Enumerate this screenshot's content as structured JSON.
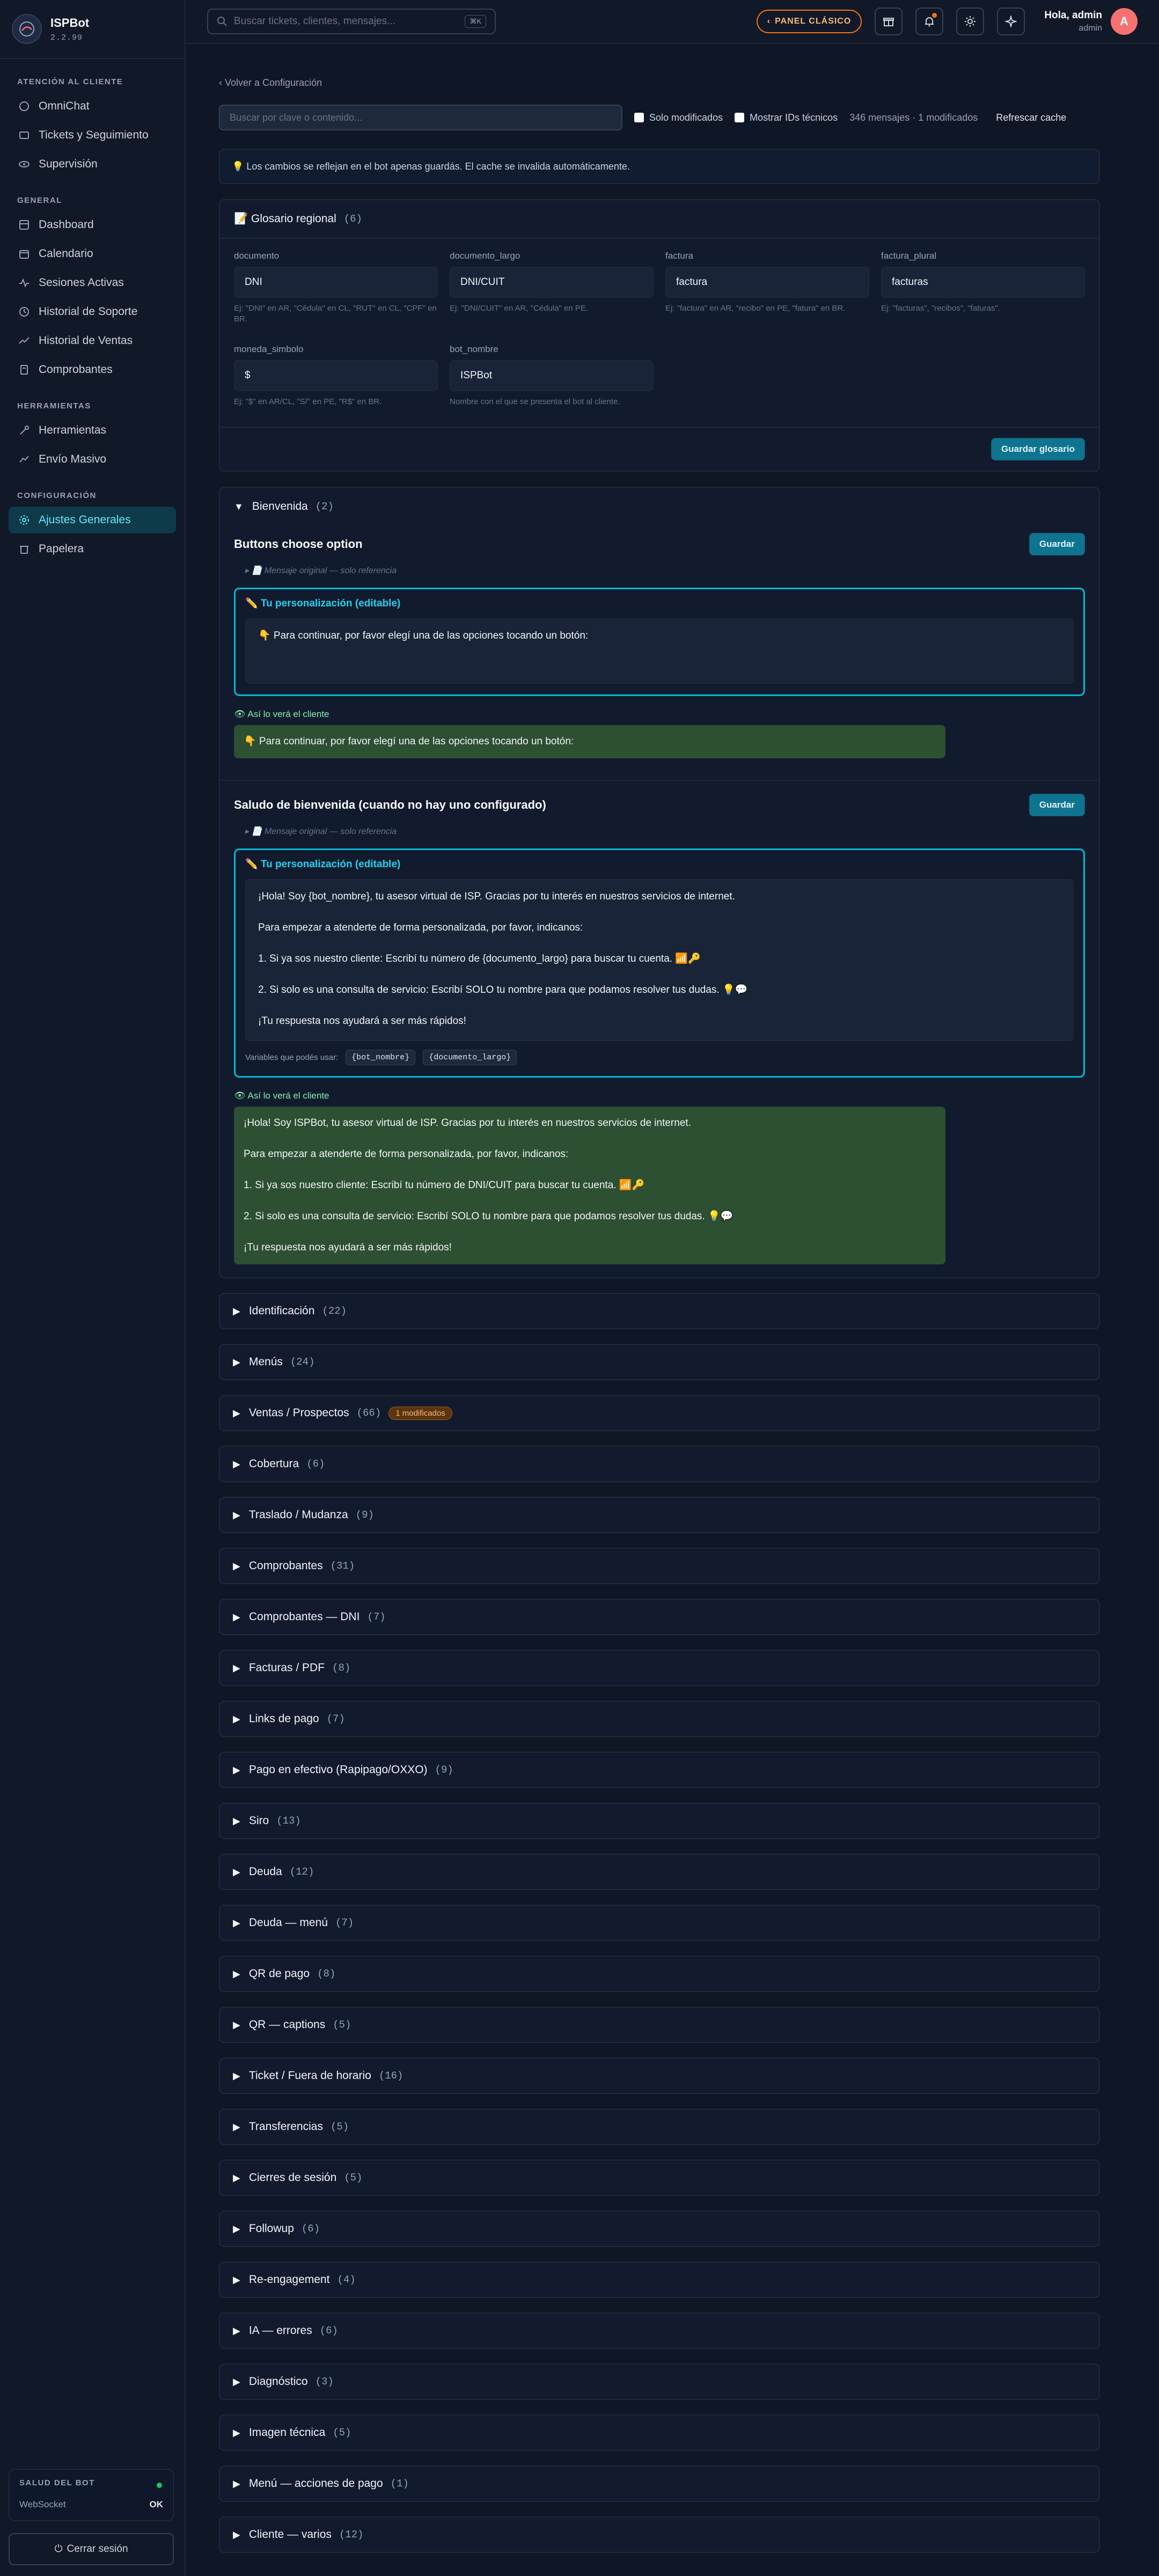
{
  "brand": {
    "name": "ISPBot",
    "version": "2.2.99"
  },
  "sidebar": {
    "sections": [
      {
        "title": "ATENCIÓN AL CLIENTE",
        "items": [
          {
            "label": "OmniChat",
            "icon": "chat-icon"
          },
          {
            "label": "Tickets y Seguimiento",
            "icon": "ticket-icon"
          },
          {
            "label": "Supervisión",
            "icon": "eye-icon"
          }
        ]
      },
      {
        "title": "GENERAL",
        "items": [
          {
            "label": "Dashboard",
            "icon": "dashboard-icon"
          },
          {
            "label": "Calendario",
            "icon": "calendar-icon"
          },
          {
            "label": "Sesiones Activas",
            "icon": "activity-icon"
          },
          {
            "label": "Historial de Soporte",
            "icon": "history-icon"
          },
          {
            "label": "Historial de Ventas",
            "icon": "trend-icon"
          },
          {
            "label": "Comprobantes",
            "icon": "receipt-icon"
          }
        ]
      },
      {
        "title": "HERRAMIENTAS",
        "items": [
          {
            "label": "Herramientas",
            "icon": "wrench-icon"
          },
          {
            "label": "Envío Masivo",
            "icon": "send-icon"
          }
        ]
      },
      {
        "title": "CONFIGURACIÓN",
        "items": [
          {
            "label": "Ajustes Generales",
            "icon": "gear-icon",
            "active": true
          },
          {
            "label": "Papelera",
            "icon": "trash-icon"
          }
        ]
      }
    ],
    "health": {
      "title": "SALUD DEL BOT",
      "label": "WebSocket",
      "value": "OK"
    },
    "logout": "Cerrar sesión"
  },
  "topbar": {
    "search_placeholder": "Buscar tickets, clientes, mensajes...",
    "shortcut": "⌘K",
    "classic_panel": "PANEL CLÁSICO",
    "greeting": "Hola, admin",
    "role": "admin",
    "avatar_letter": "A"
  },
  "page": {
    "back": "‹ Volver a Configuración",
    "search_placeholder": "Buscar por clave o contenido...",
    "only_modified": "Solo modificados",
    "show_ids": "Mostrar IDs técnicos",
    "stats": "346 mensajes · 1 modificados",
    "refresh": "Refrescar cache",
    "info": "💡 Los cambios se reflejan en el bot apenas guardás. El cache se invalida automáticamente."
  },
  "glossary": {
    "title": "📝 Glosario regional",
    "count": "(6)",
    "fields": [
      {
        "label": "documento",
        "value": "DNI",
        "hint": "Ej: \"DNI\" en AR, \"Cédula\" en CL, \"RUT\" en CL, \"CPF\" en BR."
      },
      {
        "label": "documento_largo",
        "value": "DNI/CUIT",
        "hint": "Ej: \"DNI/CUIT\" en AR, \"Cédula\" en PE."
      },
      {
        "label": "factura",
        "value": "factura",
        "hint": "Ej: \"factura\" en AR, \"recibo\" en PE, \"fatura\" en BR."
      },
      {
        "label": "factura_plural",
        "value": "facturas",
        "hint": "Ej: \"facturas\", \"recibos\", \"faturas\"."
      },
      {
        "label": "moneda_simbolo",
        "value": "$",
        "hint": "Ej: \"$\" en AR/CL, \"S/\" en PE, \"R$\" en BR."
      },
      {
        "label": "bot_nombre",
        "value": "ISPBot",
        "hint": "Nombre con el que se presenta el bot al cliente."
      }
    ],
    "save": "Guardar glosario"
  },
  "welcome": {
    "title": "Bienvenida",
    "count": "(2)",
    "original_label": "📄 Mensaje original — solo referencia",
    "edit_label": "✏️ Tu personalización (editable)",
    "preview_label": "👁 Así lo verá el cliente",
    "save": "Guardar",
    "msg1": {
      "title": "Buttons choose option",
      "text": "👇 Para continuar, por favor elegí una de las opciones tocando un botón:",
      "preview": "👇 Para continuar, por favor elegí una de las opciones tocando un botón:"
    },
    "msg2": {
      "title": "Saludo de bienvenida (cuando no hay uno configurado)",
      "lines": [
        "¡Hola! Soy {bot_nombre}, tu asesor virtual de ISP. Gracias por tu interés en nuestros servicios de internet.",
        "Para empezar a atenderte de forma personalizada, por favor, indicanos:",
        "1. Si ya sos nuestro cliente: Escribí tu número de {documento_largo} para buscar tu cuenta. 📶🔑",
        "2. Si solo es una consulta de servicio: Escribí SOLO tu nombre para que podamos resolver tus dudas. 💡💬",
        "¡Tu respuesta nos ayudará a ser más rápidos!"
      ],
      "vars_label": "Variables que podés usar:",
      "vars": [
        "{bot_nombre}",
        "{documento_largo}"
      ],
      "preview_lines": [
        "¡Hola! Soy ISPBot, tu asesor virtual de ISP. Gracias por tu interés en nuestros servicios de internet.",
        "Para empezar a atenderte de forma personalizada, por favor, indicanos:",
        "1. Si ya sos nuestro cliente: Escribí tu número de DNI/CUIT para buscar tu cuenta. 📶🔑",
        "2. Si solo es una consulta de servicio: Escribí SOLO tu nombre para que podamos resolver tus dudas. 💡💬",
        "¡Tu respuesta nos ayudará a ser más rápidos!"
      ]
    }
  },
  "categories": [
    {
      "label": "Identificación",
      "count": "(22)"
    },
    {
      "label": "Menús",
      "count": "(24)"
    },
    {
      "label": "Ventas / Prospectos",
      "count": "(66)",
      "badge": "1 modificados"
    },
    {
      "label": "Cobertura",
      "count": "(6)"
    },
    {
      "label": "Traslado / Mudanza",
      "count": "(9)"
    },
    {
      "label": "Comprobantes",
      "count": "(31)"
    },
    {
      "label": "Comprobantes — DNI",
      "count": "(7)"
    },
    {
      "label": "Facturas / PDF",
      "count": "(8)"
    },
    {
      "label": "Links de pago",
      "count": "(7)"
    },
    {
      "label": "Pago en efectivo (Rapipago/OXXO)",
      "count": "(9)"
    },
    {
      "label": "Siro",
      "count": "(13)"
    },
    {
      "label": "Deuda",
      "count": "(12)"
    },
    {
      "label": "Deuda — menú",
      "count": "(7)"
    },
    {
      "label": "QR de pago",
      "count": "(8)"
    },
    {
      "label": "QR — captions",
      "count": "(5)"
    },
    {
      "label": "Ticket / Fuera de horario",
      "count": "(16)"
    },
    {
      "label": "Transferencias",
      "count": "(5)"
    },
    {
      "label": "Cierres de sesión",
      "count": "(5)"
    },
    {
      "label": "Followup",
      "count": "(6)"
    },
    {
      "label": "Re-engagement",
      "count": "(4)"
    },
    {
      "label": "IA — errores",
      "count": "(6)"
    },
    {
      "label": "Diagnóstico",
      "count": "(3)"
    },
    {
      "label": "Imagen técnica",
      "count": "(5)"
    },
    {
      "label": "Menú — acciones de pago",
      "count": "(1)"
    },
    {
      "label": "Cliente — varios",
      "count": "(12)"
    }
  ]
}
